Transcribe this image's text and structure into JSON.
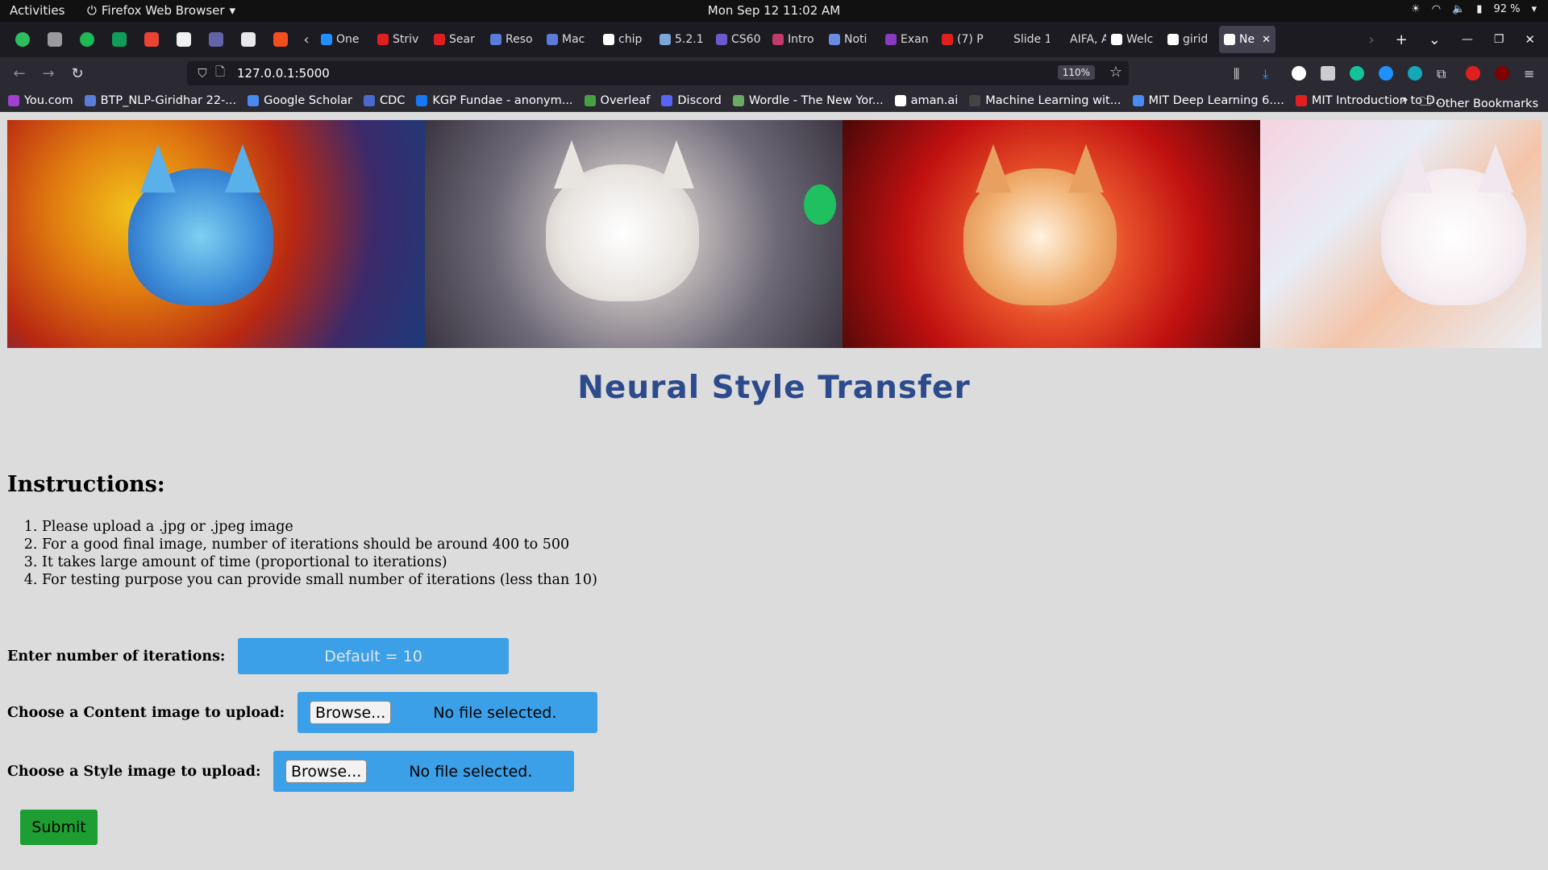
{
  "system": {
    "activities": "Activities",
    "app_name": "Firefox Web Browser",
    "clock": "Mon Sep 12  11:02 AM",
    "battery": "92 %"
  },
  "tabs": [
    {
      "label": "One",
      "color": "#1e90ff"
    },
    {
      "label": "Striv",
      "color": "#e02020"
    },
    {
      "label": "Sear",
      "color": "#e02020"
    },
    {
      "label": "Reso",
      "color": "#5a7bd8"
    },
    {
      "label": "Mac",
      "color": "#5a7bd8"
    },
    {
      "label": "chip",
      "color": "#ffffff"
    },
    {
      "label": "5.2.1",
      "color": "#7aa6d8"
    },
    {
      "label": "CS60",
      "color": "#6a5acd"
    },
    {
      "label": "Intro",
      "color": "#c03a6a"
    },
    {
      "label": "Noti",
      "color": "#6a8ce0"
    },
    {
      "label": "Exan",
      "color": "#8a3ac0"
    },
    {
      "label": "(7) P",
      "color": "#e02020"
    },
    {
      "label": "Slide 1 -",
      "color": "#1c1b22"
    },
    {
      "label": "AIFA, A",
      "color": "#1c1b22"
    },
    {
      "label": "Welc",
      "color": "#ffffff"
    },
    {
      "label": "girid",
      "color": "#ffffff"
    }
  ],
  "active_tab": {
    "label": "Ne",
    "close": "✕"
  },
  "urlbar": {
    "url": "127.0.0.1:5000",
    "zoom": "110%"
  },
  "bookmarks": [
    {
      "label": "You.com",
      "color": "#a040d0"
    },
    {
      "label": "BTP_NLP-Giridhar 22-...",
      "color": "#5a7bd8"
    },
    {
      "label": "Google Scholar",
      "color": "#4a8af0"
    },
    {
      "label": "CDC",
      "color": "#4a6ad0"
    },
    {
      "label": "KGP Fundae - anonym...",
      "color": "#1877f2"
    },
    {
      "label": "Overleaf",
      "color": "#47a141"
    },
    {
      "label": "Discord",
      "color": "#5865f2"
    },
    {
      "label": "Wordle - The New Yor...",
      "color": "#6aaa64"
    },
    {
      "label": "aman.ai",
      "color": "#ffffff"
    },
    {
      "label": "Machine Learning wit...",
      "color": "#444444"
    },
    {
      "label": "MIT Deep Learning 6....",
      "color": "#4a8af0"
    },
    {
      "label": "MIT Introduction to D...",
      "color": "#e02020"
    }
  ],
  "bookmarks_other": "Other Bookmarks",
  "page": {
    "title": "Neural Style Transfer",
    "instructions_heading": "Instructions:",
    "instructions": [
      "Please upload a .jpg or .jpeg image",
      "For a good final image, number of iterations should be around 400 to 500",
      "It takes large amount of time (proportional to iterations)",
      "For testing purpose you can provide small number of iterations (less than 10)"
    ],
    "iterations_label": "Enter number of iterations:",
    "iterations_placeholder": "Default = 10",
    "content_label": "Choose a Content image to upload:",
    "style_label": "Choose a Style image to upload:",
    "browse_label": "Browse...",
    "no_file": "No file selected.",
    "submit_label": "Submit"
  }
}
